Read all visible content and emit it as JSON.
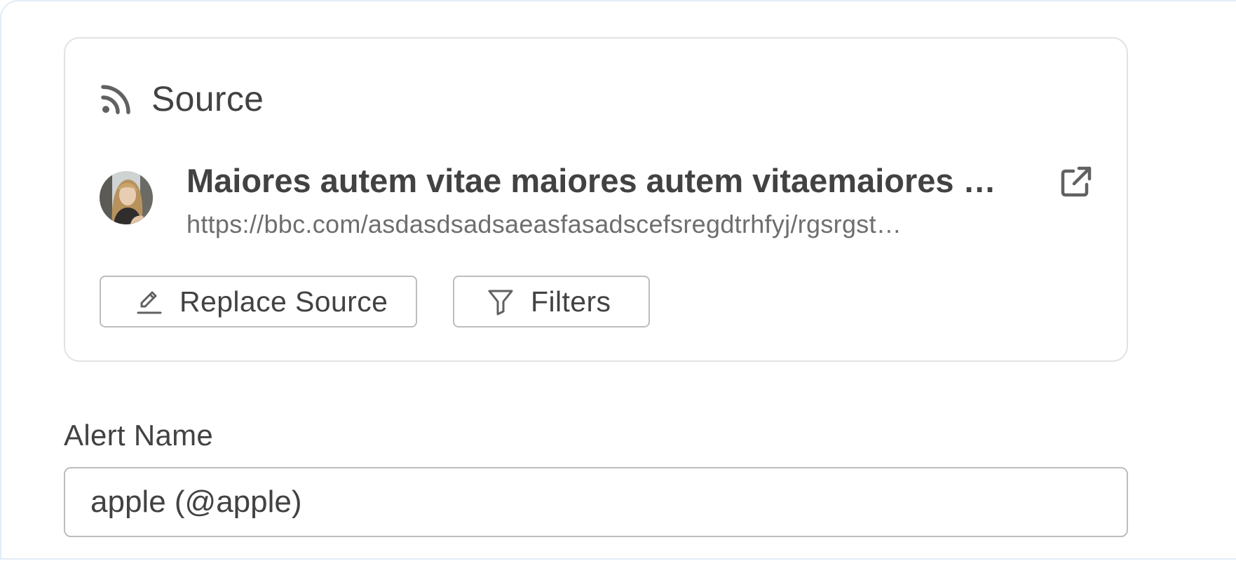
{
  "source": {
    "heading": "Source",
    "header_icon": "rss-icon",
    "item": {
      "avatar_icon": "avatar",
      "title": "Maiores autem vitae maiores autem vitaemaiores a…",
      "url": "https://bbc.com/asdasdsadsaeasfasadscefsregdtrhfyj/rgsrgst…",
      "link_icon": "external-link-icon"
    },
    "buttons": {
      "replace_label": "Replace Source",
      "replace_icon": "pencil-icon",
      "filters_label": "Filters",
      "filters_icon": "filter-icon"
    }
  },
  "alert_name": {
    "label": "Alert Name",
    "value": "apple (@apple)"
  },
  "colors": {
    "text": "#424242",
    "muted_text": "#6e6e6e",
    "border": "#bdbdbd",
    "card_border": "#e2e2e2",
    "frame_border": "#e3ecf8"
  }
}
